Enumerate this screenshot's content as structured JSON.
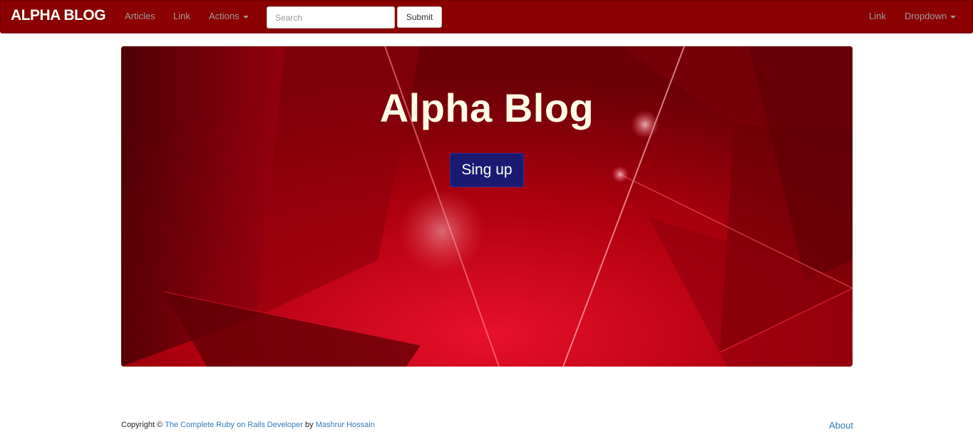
{
  "navbar": {
    "brand": "ALPHA BLOG",
    "left_links": [
      "Articles",
      "Link"
    ],
    "actions_label": "Actions",
    "search": {
      "placeholder": "Search",
      "value": ""
    },
    "submit_label": "Submit",
    "right_link": "Link",
    "dropdown_label": "Dropdown",
    "background_color": "#8b0000"
  },
  "hero": {
    "title": "Alpha Blog",
    "signup_label": "Sing up",
    "signup_color": "#1a1a72"
  },
  "footer": {
    "copyright_prefix": "Copyright ©",
    "course_link": "The Complete Ruby on Rails Developer",
    "by_text": "by",
    "author_link": "Mashrur Hossain",
    "about_link": "About"
  },
  "icons": [
    "caret-down-icon"
  ]
}
